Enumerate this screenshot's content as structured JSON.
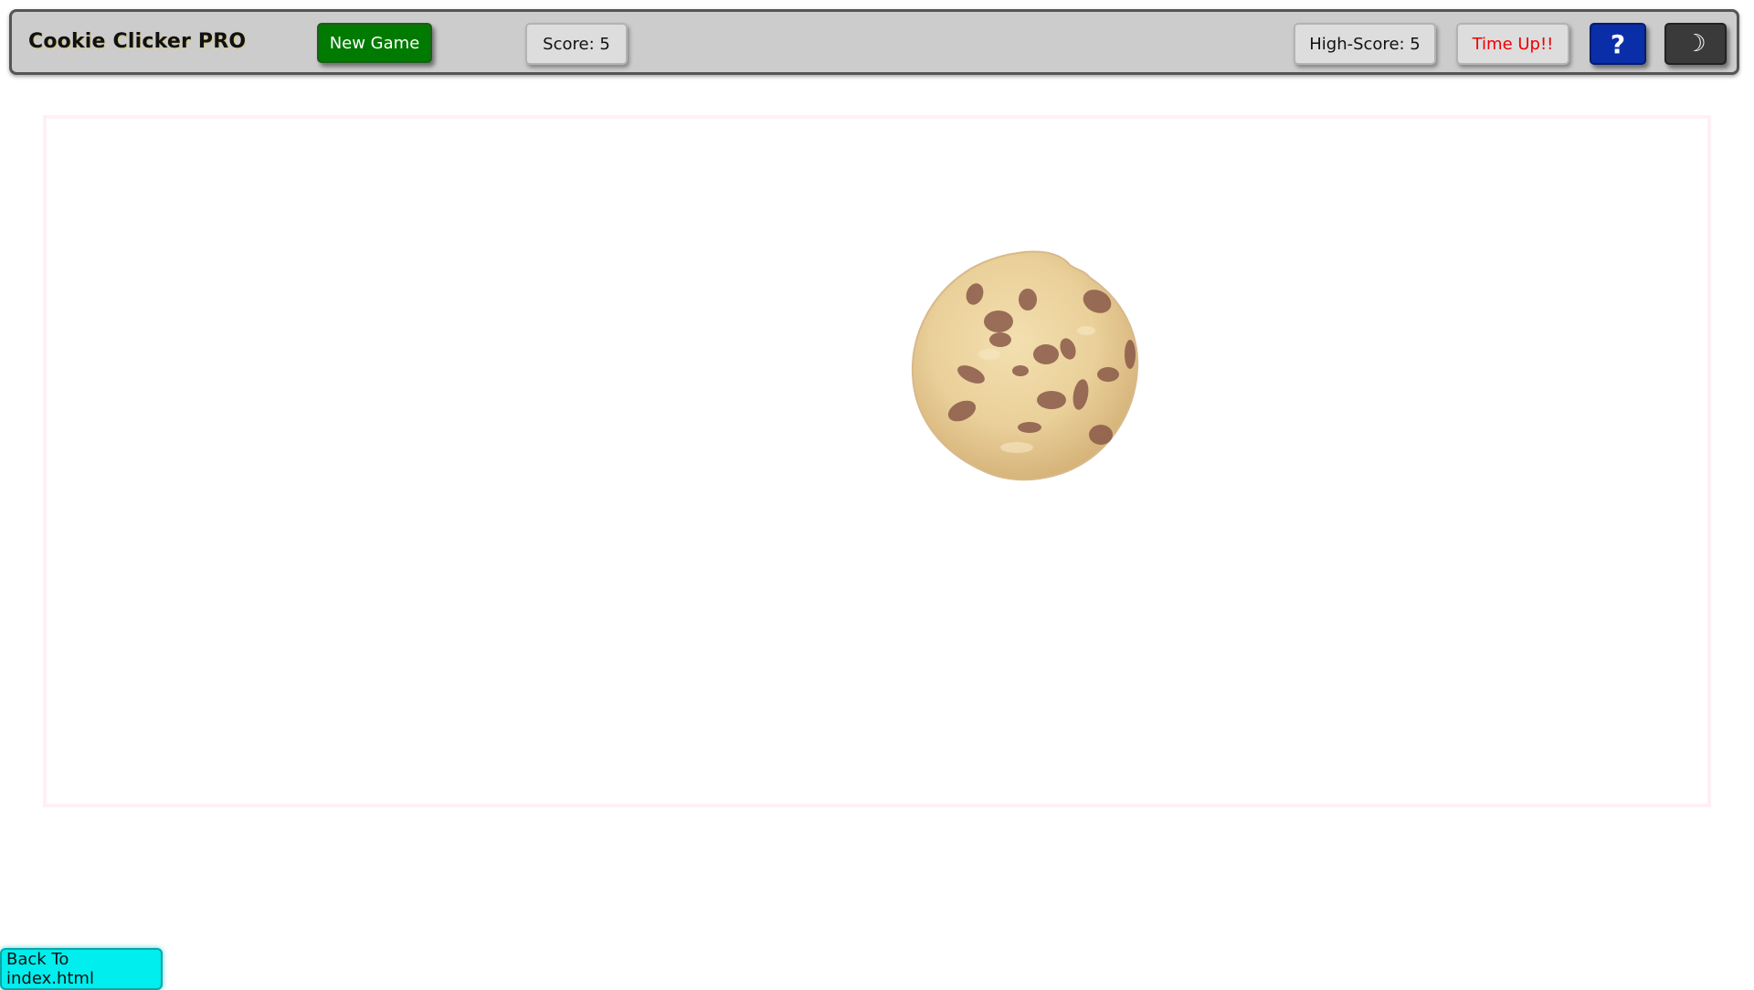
{
  "header": {
    "title": "Cookie Clicker PRO",
    "new_game_label": "New Game",
    "score_label": "Score: 5",
    "high_score_label": "High-Score: 5",
    "timer_label": "Time Up!!",
    "help_label": "?",
    "theme_toggle_glyph": "☽",
    "help_icon": "question-icon",
    "theme_icon": "moon-icon"
  },
  "game": {
    "cookie_icon": "cookie-icon"
  },
  "footer": {
    "back_label": "Back To index.html"
  },
  "colors": {
    "new_game_bg": "#007a00",
    "help_bg": "#0a2ea8",
    "theme_bg": "#3a3a3a",
    "timer_text": "#ee0000",
    "back_bg": "#00eeee",
    "header_bg": "#cccccc"
  }
}
